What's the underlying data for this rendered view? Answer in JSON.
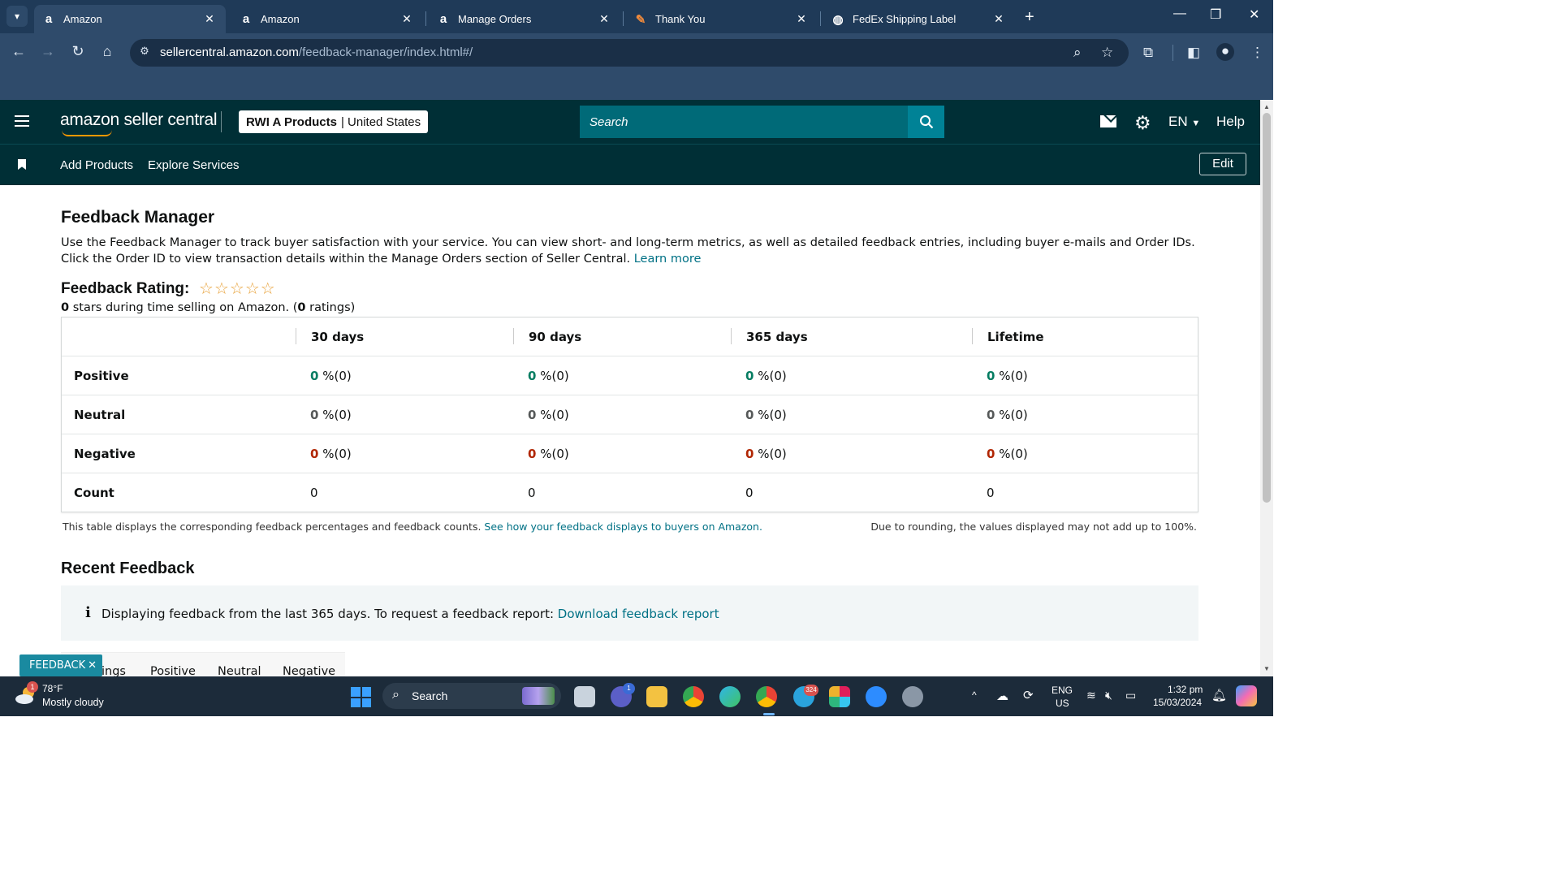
{
  "browser": {
    "tabs": [
      {
        "title": "Amazon",
        "favicon": "amazon-a-icon",
        "active": true
      },
      {
        "title": "Amazon",
        "favicon": "amazon-a-icon",
        "active": false
      },
      {
        "title": "Manage Orders",
        "favicon": "amazon-a-icon",
        "active": false
      },
      {
        "title": "Thank You",
        "favicon": "pen-icon",
        "active": false
      },
      {
        "title": "FedEx Shipping Label",
        "favicon": "globe-icon",
        "active": false
      }
    ],
    "url_host": "sellercentral.amazon.com",
    "url_path": "/feedback-manager/index.html#/"
  },
  "header": {
    "logo_text": "amazon seller central",
    "account_name": "RWI A Products",
    "account_region": "United States",
    "search_placeholder": "Search",
    "language": "EN",
    "help_label": "Help"
  },
  "nav": {
    "links": [
      "Add Products",
      "Explore Services"
    ],
    "edit_label": "Edit"
  },
  "page": {
    "title": "Feedback Manager",
    "intro_text": "Use the Feedback Manager to track buyer satisfaction with your service. You can view short- and long-term metrics, as well as detailed feedback entries, including buyer e-mails and Order IDs. Click the Order ID to view transaction details within the Manage Orders section of Seller Central.",
    "learn_more": "Learn more",
    "rating_title": "Feedback Rating:",
    "stars_shown": 0,
    "rating_stars_value": "0",
    "rating_sub_mid": " stars during time selling on Amazon. (",
    "rating_count": "0",
    "rating_sub_end": " ratings)",
    "table": {
      "columns": [
        "30 days",
        "90 days",
        "365 days",
        "Lifetime"
      ],
      "rows": [
        {
          "label": "Positive",
          "values": [
            "0",
            "0",
            "0",
            "0"
          ],
          "counts": [
            "%(0)",
            "%(0)",
            "%(0)",
            "%(0)"
          ],
          "tone": "pos"
        },
        {
          "label": "Neutral",
          "values": [
            "0",
            "0",
            "0",
            "0"
          ],
          "counts": [
            "%(0)",
            "%(0)",
            "%(0)",
            "%(0)"
          ],
          "tone": "neu"
        },
        {
          "label": "Negative",
          "values": [
            "0",
            "0",
            "0",
            "0"
          ],
          "counts": [
            "%(0)",
            "%(0)",
            "%(0)",
            "%(0)"
          ],
          "tone": "neg"
        },
        {
          "label": "Count",
          "values": [
            "0",
            "0",
            "0",
            "0"
          ],
          "counts": [
            "",
            "",
            "",
            ""
          ],
          "tone": "plain"
        }
      ]
    },
    "table_note": "This table displays the corresponding feedback percentages and feedback counts.",
    "table_note_link": "See how your feedback displays to buyers on Amazon.",
    "rounding_note": "Due to rounding, the values displayed may not add up to 100%.",
    "recent_title": "Recent Feedback",
    "info_text": "Displaying feedback from the last 365 days. To request a feedback report:",
    "info_link": "Download feedback report",
    "feedback_tabs": [
      "ings",
      "Positive",
      "Neutral",
      "Negative"
    ],
    "feedback_widget_label": "FEEDBACK"
  },
  "taskbar": {
    "weather_temp": "78°F",
    "weather_desc": "Mostly cloudy",
    "weather_badge": "1",
    "search_label": "Search",
    "teams_badge": "1",
    "telegram_badge": "324",
    "language_top": "ENG",
    "language_bottom": "US",
    "time": "1:32 pm",
    "date": "15/03/2024"
  },
  "colors": {
    "header_bg": "#002f36",
    "link": "#007185",
    "positive": "#067d62",
    "negative": "#b12704",
    "star": "#e8a33c"
  }
}
